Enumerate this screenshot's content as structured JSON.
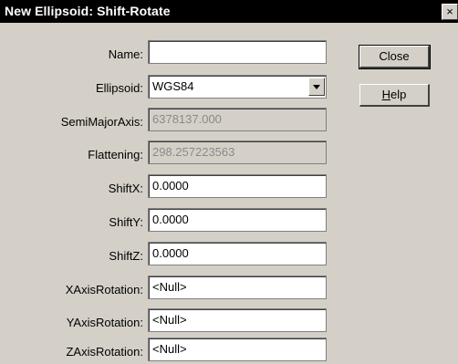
{
  "window": {
    "title": "New Ellipsoid: Shift-Rotate",
    "close_glyph": "×"
  },
  "form": {
    "name": {
      "label": "Name:",
      "value": ""
    },
    "ellipsoid": {
      "label": "Ellipsoid:",
      "value": "WGS84"
    },
    "semi_major_axis": {
      "label": "SemiMajorAxis:",
      "value": "6378137.000"
    },
    "flattening": {
      "label": "Flattening:",
      "value": "298.257223563"
    },
    "shift_x": {
      "label": "ShiftX:",
      "value": "0.0000"
    },
    "shift_y": {
      "label": "ShiftY:",
      "value": "0.0000"
    },
    "shift_z": {
      "label": "ShiftZ:",
      "value": "0.0000"
    },
    "x_axis_rotation": {
      "label": "XAxisRotation:",
      "value": "<Null>"
    },
    "y_axis_rotation": {
      "label": "YAxisRotation:",
      "value": "<Null>"
    },
    "z_axis_rotation": {
      "label": "ZAxisRotation:",
      "value": "<Null>"
    }
  },
  "buttons": {
    "close_label": "Close",
    "help_mnemonic": "H",
    "help_rest": "elp"
  },
  "icons": {
    "dropdown": "chevron-down-icon",
    "close": "close-icon"
  }
}
